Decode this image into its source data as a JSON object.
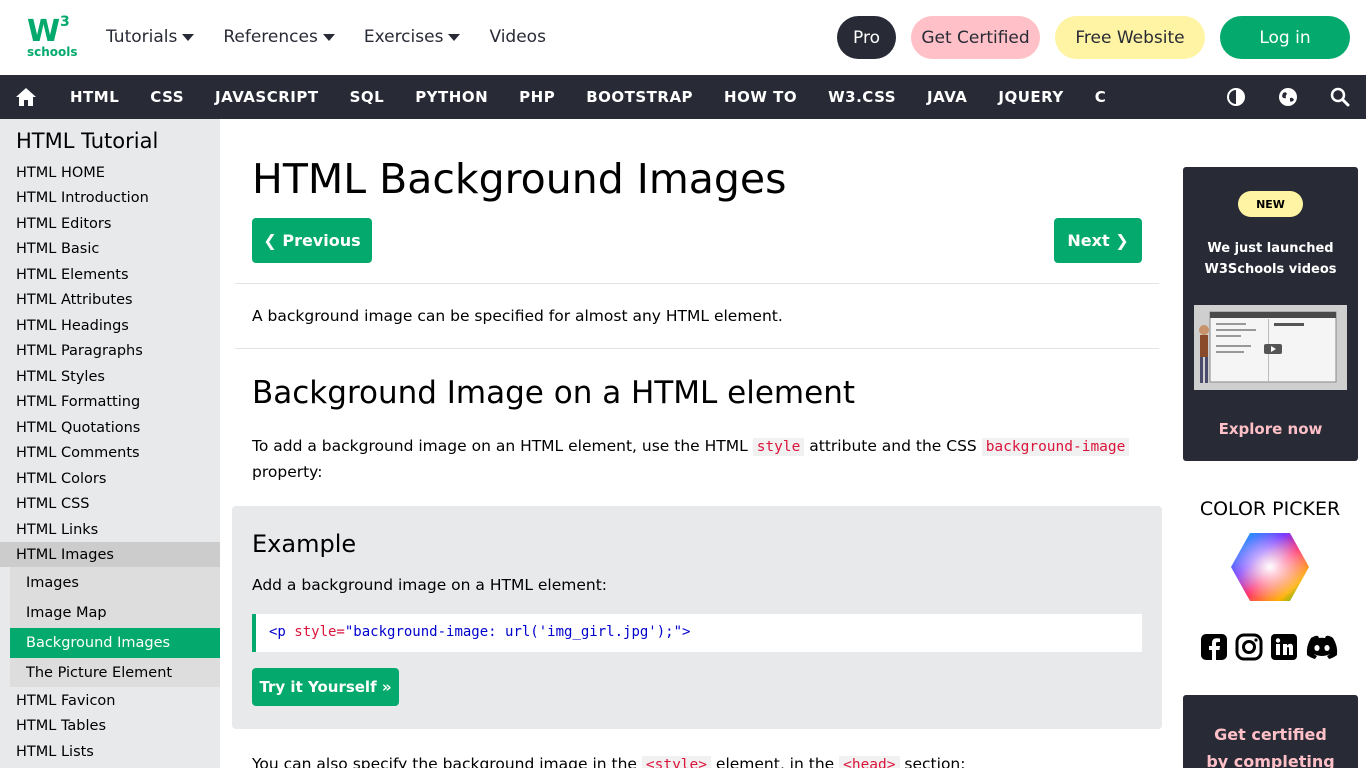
{
  "logo": {
    "main": "W",
    "sup": "3",
    "sub": "schools"
  },
  "topnav": {
    "items": [
      "Tutorials",
      "References",
      "Exercises",
      "Videos"
    ],
    "pro": "Pro",
    "get_certified": "Get Certified",
    "free_website": "Free Website",
    "login": "Log in"
  },
  "darknav": {
    "links": [
      "HTML",
      "CSS",
      "JAVASCRIPT",
      "SQL",
      "PYTHON",
      "PHP",
      "BOOTSTRAP",
      "HOW TO",
      "W3.CSS",
      "JAVA",
      "JQUERY",
      "C"
    ]
  },
  "sidebar": {
    "title": "HTML Tutorial",
    "links": [
      "HTML HOME",
      "HTML Introduction",
      "HTML Editors",
      "HTML Basic",
      "HTML Elements",
      "HTML Attributes",
      "HTML Headings",
      "HTML Paragraphs",
      "HTML Styles",
      "HTML Formatting",
      "HTML Quotations",
      "HTML Comments",
      "HTML Colors",
      "HTML CSS",
      "HTML Links",
      "HTML Images"
    ],
    "sub_links": [
      "Images",
      "Image Map",
      "Background Images",
      "The Picture Element"
    ],
    "after_links": [
      "HTML Favicon",
      "HTML Tables",
      "HTML Lists"
    ]
  },
  "main": {
    "title": "HTML Background Images",
    "prev": "❮ Previous",
    "next": "Next ❯",
    "intro": "A background image can be specified for almost any HTML element.",
    "h2": "Background Image on a HTML element",
    "p1_a": "To add a background image on an HTML element, use the HTML ",
    "p1_code1": "style",
    "p1_b": " attribute and the CSS ",
    "p1_code2": "background-image",
    "p1_c": "property:",
    "example": {
      "heading": "Example",
      "desc": "Add a background image on a HTML element:",
      "code_tag_open": "<p",
      "code_attr": " style=",
      "code_val": "\"background-image: url('img_girl.jpg');\"",
      "code_tag_close": ">",
      "try": "Try it Yourself »"
    },
    "p2_a": "You can also specify the background image in the ",
    "p2_code1": "<style>",
    "p2_b": " element, in the ",
    "p2_code2": "<head>",
    "p2_c": " section:"
  },
  "right": {
    "new_badge": "NEW",
    "promo_line1": "We just launched",
    "promo_line2": "W3Schools videos",
    "explore": "Explore now",
    "picker_title": "COLOR PICKER",
    "cert_line1": "Get certified",
    "cert_line2": "by completing"
  },
  "colors": {
    "brand": "#04AA6D",
    "dark": "#282A35",
    "pink": "#FFC0C7",
    "yellow": "#FFF4A3"
  }
}
